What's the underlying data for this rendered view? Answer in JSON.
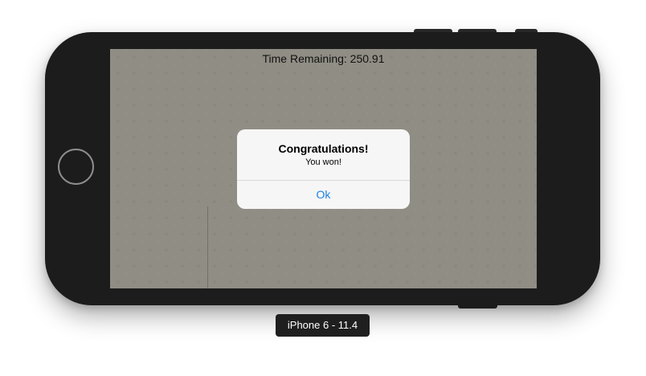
{
  "game": {
    "timer_text": "Time Remaining: 250.91"
  },
  "alert": {
    "title": "Congratulations!",
    "message": "You won!",
    "ok_label": "Ok"
  },
  "simulator": {
    "device_label": "iPhone 6 - 11.4"
  },
  "colors": {
    "screen_background": "#908d84",
    "alert_button_text": "#1a82e2",
    "device_body": "#1c1c1c"
  }
}
